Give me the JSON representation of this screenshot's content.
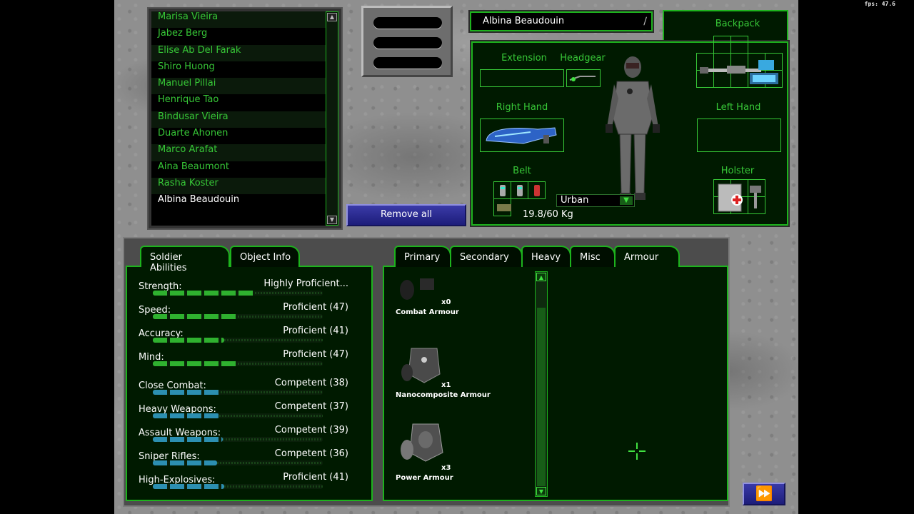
{
  "fps": "fps: 47.6",
  "soldiers": [
    {
      "name": "Marisa Vieira",
      "selected": false
    },
    {
      "name": "Jabez Berg",
      "selected": false
    },
    {
      "name": "Elise Ab Del Farak",
      "selected": false
    },
    {
      "name": "Shiro Huong",
      "selected": false
    },
    {
      "name": "Manuel Pillai",
      "selected": false
    },
    {
      "name": "Henrique Tao",
      "selected": false
    },
    {
      "name": "Bindusar Vieira",
      "selected": false
    },
    {
      "name": "Duarte Ahonen",
      "selected": false
    },
    {
      "name": "Marco Arafat",
      "selected": false
    },
    {
      "name": "Aina Beaumont",
      "selected": false
    },
    {
      "name": "Rasha Koster",
      "selected": false
    },
    {
      "name": "Albina Beaudouin",
      "selected": true
    }
  ],
  "remove_all": "Remove all",
  "equipment": {
    "soldier_name": "Albina Beaudouin",
    "labels": {
      "backpack": "Backpack",
      "extension": "Extension",
      "headgear": "Headgear",
      "right_hand": "Right Hand",
      "left_hand": "Left Hand",
      "belt": "Belt",
      "holster": "Holster"
    },
    "armour_type": "Urban",
    "weight": "19.8/60 Kg"
  },
  "ability_tabs": [
    "Soldier Abilities",
    "Object Info"
  ],
  "abilities": [
    {
      "name": "Strength:",
      "value": "Highly Proficient...",
      "level": 0.6,
      "color": "green"
    },
    {
      "name": "Speed:",
      "value": "Proficient (47)",
      "level": 0.5,
      "color": "green"
    },
    {
      "name": "Accuracy:",
      "value": "Proficient (41)",
      "level": 0.42,
      "color": "green"
    },
    {
      "name": "Mind:",
      "value": "Proficient (47)",
      "level": 0.5,
      "color": "green"
    },
    {
      "name": "Close Combat:",
      "value": "Competent (38)",
      "level": 0.4,
      "color": "blue"
    },
    {
      "name": "Heavy Weapons:",
      "value": "Competent (37)",
      "level": 0.39,
      "color": "blue"
    },
    {
      "name": "Assault Weapons:",
      "value": "Competent (39)",
      "level": 0.41,
      "color": "blue"
    },
    {
      "name": "Sniper Rifles:",
      "value": "Competent (36)",
      "level": 0.38,
      "color": "blue"
    },
    {
      "name": "High-Explosives:",
      "value": "Proficient (41)",
      "level": 0.42,
      "color": "blue"
    }
  ],
  "item_tabs": [
    "Primary",
    "Secondary",
    "Heavy",
    "Misc",
    "Armour"
  ],
  "items": [
    {
      "name": "Combat Armour",
      "qty": "x0"
    },
    {
      "name": "Nanocomposite Armour",
      "qty": "x1"
    },
    {
      "name": "Power Armour",
      "qty": "x3"
    }
  ],
  "colors": {
    "panel_green": "#1db31d",
    "text_green": "#37c837",
    "button_blue": "#2a2a90"
  }
}
